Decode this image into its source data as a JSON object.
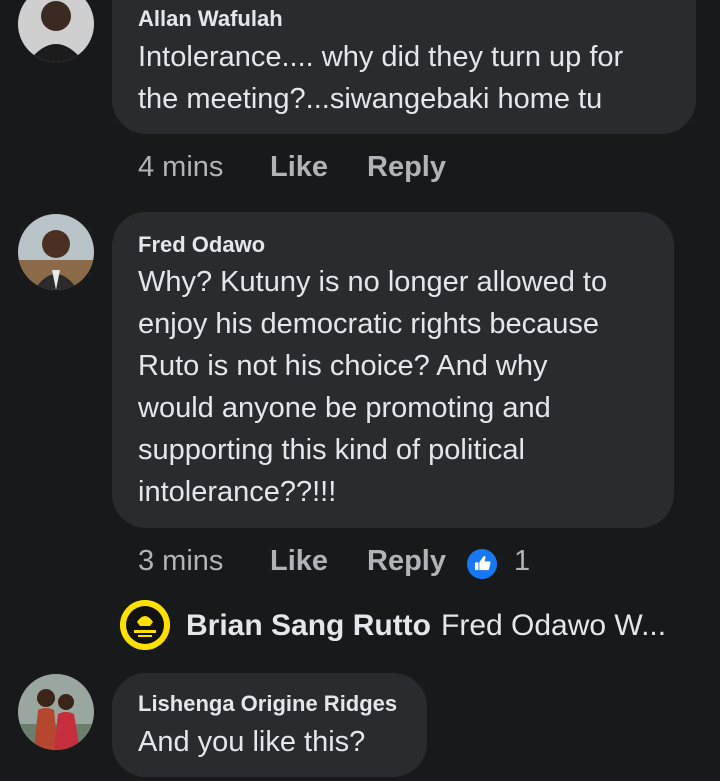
{
  "comments": [
    {
      "author": "Allan Wafulah",
      "text": "Intolerance.... why did they turn up for\nthe meeting?...siwangebaki home tu",
      "time": "4 mins",
      "like_label": "Like",
      "reply_label": "Reply"
    },
    {
      "author": "Fred Odawo",
      "text": "Why? Kutuny is no longer allowed to\nenjoy his democratic rights because\nRuto is not his choice? And why\nwould anyone be promoting and\nsupporting this kind of political\nintolerance??!!!",
      "time": "3 mins",
      "like_label": "Like",
      "reply_label": "Reply",
      "reaction_count": "1",
      "reply_preview": {
        "author": "Brian Sang Rutto",
        "text": "Fred Odawo W..."
      }
    },
    {
      "author": "Lishenga Origine Ridges",
      "text": "And you like this?"
    }
  ],
  "icons": {
    "reaction": "thumbs-up-icon",
    "reaction_color": "#1877f2"
  }
}
